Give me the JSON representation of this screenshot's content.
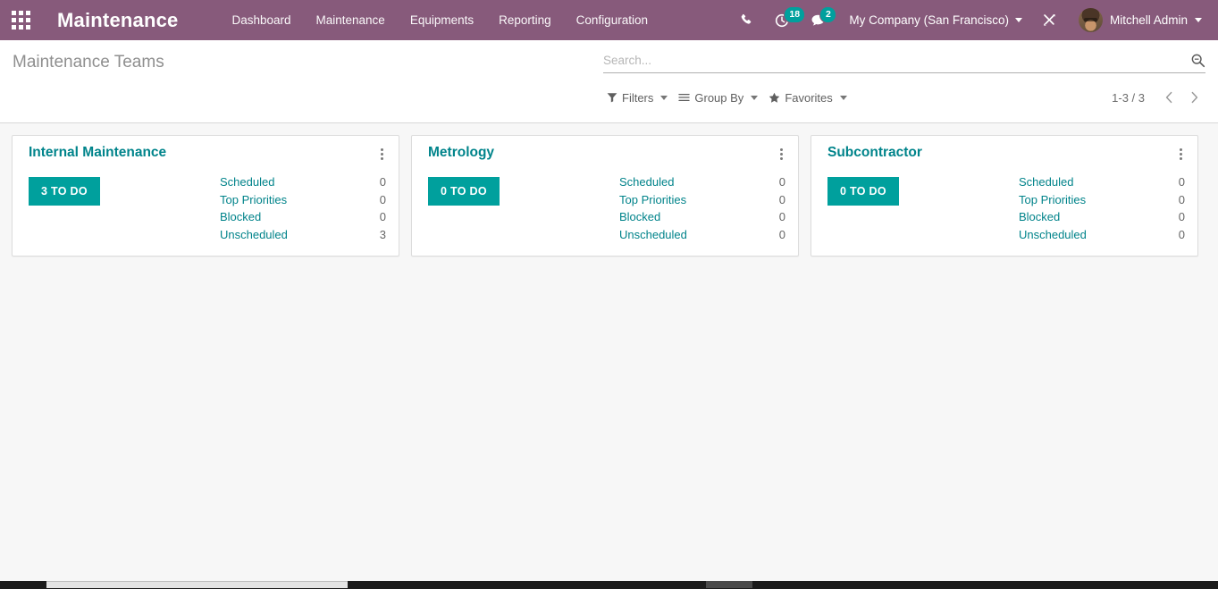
{
  "navbar": {
    "apps_menu": "apps-grid",
    "brand": "Maintenance",
    "menu_items": [
      {
        "label": "Dashboard"
      },
      {
        "label": "Maintenance"
      },
      {
        "label": "Equipments"
      },
      {
        "label": "Reporting"
      },
      {
        "label": "Configuration"
      }
    ],
    "systray": {
      "phone_icon": "phone-icon",
      "activities_icon": "clock-icon",
      "activities_count": "18",
      "messages_icon": "chat-icon",
      "messages_count": "2",
      "company": "My Company (San Francisco)",
      "debug_icon": "bug-tools-icon",
      "user_name": "Mitchell Admin"
    }
  },
  "control_panel": {
    "breadcrumb": "Maintenance Teams",
    "search": {
      "value": "",
      "placeholder": "Search...",
      "icon": "search-icon"
    },
    "filters": [
      {
        "label": "Filters",
        "icon": "funnel-icon"
      },
      {
        "label": "Group By",
        "icon": "bars-icon"
      },
      {
        "label": "Favorites",
        "icon": "star-icon"
      }
    ],
    "pager": {
      "value": "1-3 / 3",
      "prev_icon": "chevron-left-icon",
      "next_icon": "chevron-right-icon"
    }
  },
  "kanban": {
    "stat_labels": [
      "Scheduled",
      "Top Priorities",
      "Blocked",
      "Unscheduled"
    ],
    "cards": [
      {
        "title": "Internal Maintenance",
        "todo_label": "3 TO DO",
        "stats": [
          {
            "label": "Scheduled",
            "value": "0"
          },
          {
            "label": "Top Priorities",
            "value": "0"
          },
          {
            "label": "Blocked",
            "value": "0"
          },
          {
            "label": "Unscheduled",
            "value": "3"
          }
        ]
      },
      {
        "title": "Metrology",
        "todo_label": "0 TO DO",
        "stats": [
          {
            "label": "Scheduled",
            "value": "0"
          },
          {
            "label": "Top Priorities",
            "value": "0"
          },
          {
            "label": "Blocked",
            "value": "0"
          },
          {
            "label": "Unscheduled",
            "value": "0"
          }
        ]
      },
      {
        "title": "Subcontractor",
        "todo_label": "0 TO DO",
        "stats": [
          {
            "label": "Scheduled",
            "value": "0"
          },
          {
            "label": "Top Priorities",
            "value": "0"
          },
          {
            "label": "Blocked",
            "value": "0"
          },
          {
            "label": "Unscheduled",
            "value": "0"
          }
        ]
      }
    ]
  },
  "colors": {
    "brand_purple": "#875A7B",
    "accent_teal": "#00A09D",
    "link_teal": "#00838a",
    "page_bg": "#f7f7f7"
  }
}
